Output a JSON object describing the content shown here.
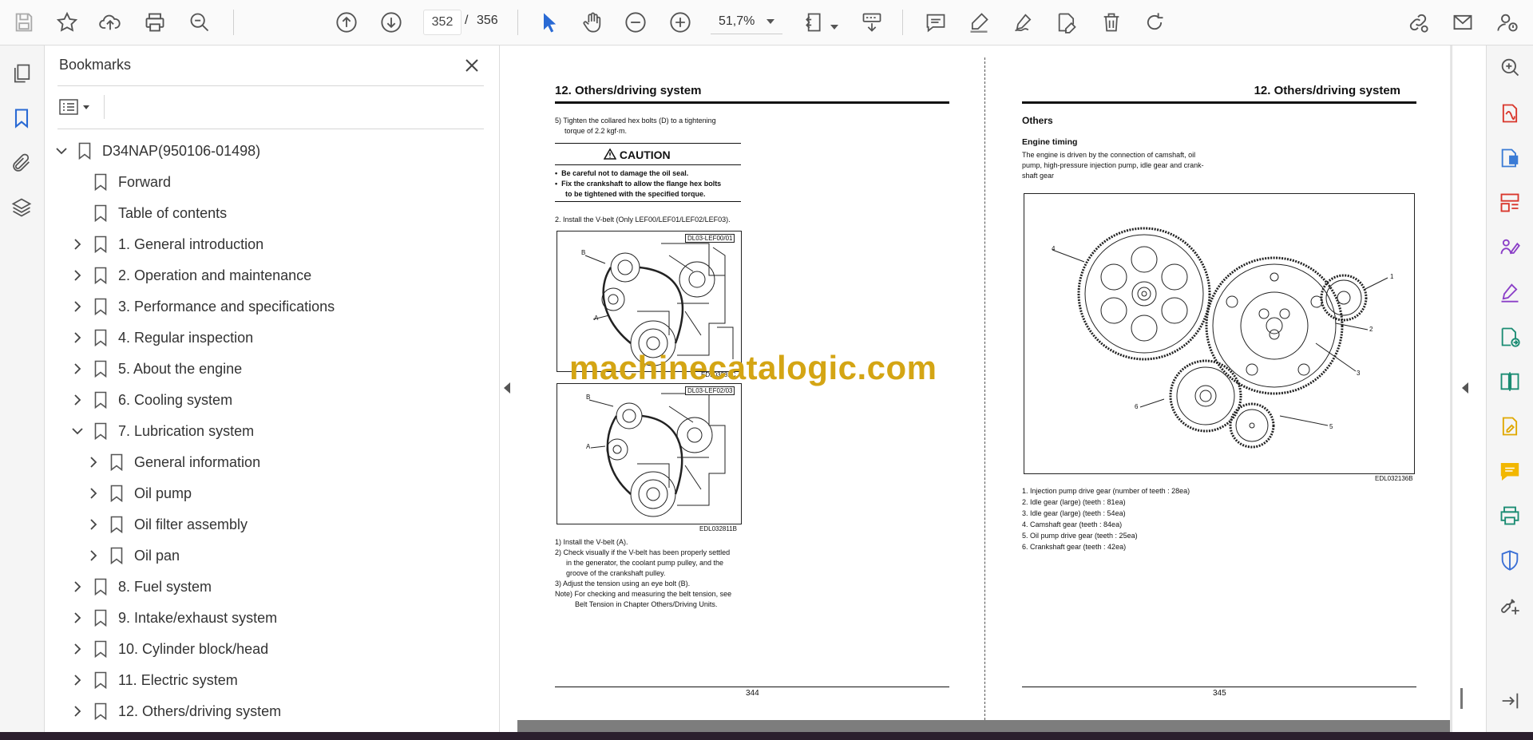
{
  "toolbar": {
    "current_page": "352",
    "page_separator": "/",
    "total_pages": "356",
    "zoom": "51,7%"
  },
  "bookmarks": {
    "title": "Bookmarks",
    "items": [
      {
        "label": "D34NAP(950106-01498)",
        "level": 0,
        "state": "expanded"
      },
      {
        "label": "Forward",
        "level": 1,
        "state": "none"
      },
      {
        "label": "Table of contents",
        "level": 1,
        "state": "none"
      },
      {
        "label": "1. General introduction",
        "level": 1,
        "state": "collapsed"
      },
      {
        "label": "2. Operation and maintenance",
        "level": 1,
        "state": "collapsed"
      },
      {
        "label": "3. Performance and specifications",
        "level": 1,
        "state": "collapsed"
      },
      {
        "label": "4. Regular inspection",
        "level": 1,
        "state": "collapsed"
      },
      {
        "label": "5. About the engine",
        "level": 1,
        "state": "collapsed"
      },
      {
        "label": "6. Cooling system",
        "level": 1,
        "state": "collapsed"
      },
      {
        "label": "7. Lubrication system",
        "level": 1,
        "state": "expanded"
      },
      {
        "label": "General information",
        "level": 2,
        "state": "collapsed"
      },
      {
        "label": "Oil pump",
        "level": 2,
        "state": "collapsed"
      },
      {
        "label": "Oil filter assembly",
        "level": 2,
        "state": "collapsed"
      },
      {
        "label": "Oil pan",
        "level": 2,
        "state": "collapsed"
      },
      {
        "label": "8. Fuel system",
        "level": 1,
        "state": "collapsed"
      },
      {
        "label": "9. Intake/exhaust system",
        "level": 1,
        "state": "collapsed"
      },
      {
        "label": "10. Cylinder block/head",
        "level": 1,
        "state": "collapsed"
      },
      {
        "label": "11. Electric system",
        "level": 1,
        "state": "collapsed"
      },
      {
        "label": "12. Others/driving system",
        "level": 1,
        "state": "collapsed"
      }
    ]
  },
  "left_page": {
    "header": "12. Others/driving system",
    "step5_line1": "5)  Tighten the collared hex bolts (D) to a tightening",
    "step5_line2": "torque of 2.2 kgf·m.",
    "caution_title": "CAUTION",
    "caution_1": "Be careful not to damage the oil seal.",
    "caution_2a": "Fix the crankshaft to allow the flange hex bolts",
    "caution_2b": "to be tightened with the specified torque.",
    "install_vbelt": "2.  Install the V-belt (Only LEF00/LEF01/LEF02/LEF03).",
    "fig1_tag": "DL03-LEF00/01",
    "fig2_tag": "DL03-LEF02/03",
    "fig_label_a": "A",
    "fig_label_b": "B",
    "fig_code": "EDL032811B",
    "fig_code_partial": "EDL03281C",
    "s1": "1)  Install the V-belt (A).",
    "s2a": "2)  Check visually if the V-belt has been properly settled",
    "s2b": "in the generator, the coolant pump pulley, and the",
    "s2c": "groove of the crankshaft pulley.",
    "s3": "3)  Adjust the tension using an eye bolt (B).",
    "note_a": "Note)  For checking and measuring the belt tension, see",
    "note_b": "Belt Tension in Chapter Others/Driving Units.",
    "page_number": "344"
  },
  "right_page": {
    "header": "12. Others/driving system",
    "section": "Others",
    "subsection": "Engine timing",
    "desc_a": "The engine is driven by the connection of camshaft, oil",
    "desc_b": "pump, high-pressure injection pump, idle gear and crank-",
    "desc_c": "shaft gear",
    "fig_code": "EDL032136B",
    "callouts": [
      "1",
      "2",
      "3",
      "4",
      "5",
      "6"
    ],
    "gears": [
      "1.  Injection pump drive gear (number of teeth : 28ea)",
      "2.  Idle gear (large) (teeth : 81ea)",
      "3.  Idle gear (large) (teeth : 54ea)",
      "4.  Camshaft gear (teeth : 84ea)",
      "5.  Oil pump drive gear (teeth : 25ea)",
      "6.  Crankshaft gear (teeth : 42ea)"
    ],
    "page_number": "345"
  },
  "watermark": "machinecatalogic.com"
}
